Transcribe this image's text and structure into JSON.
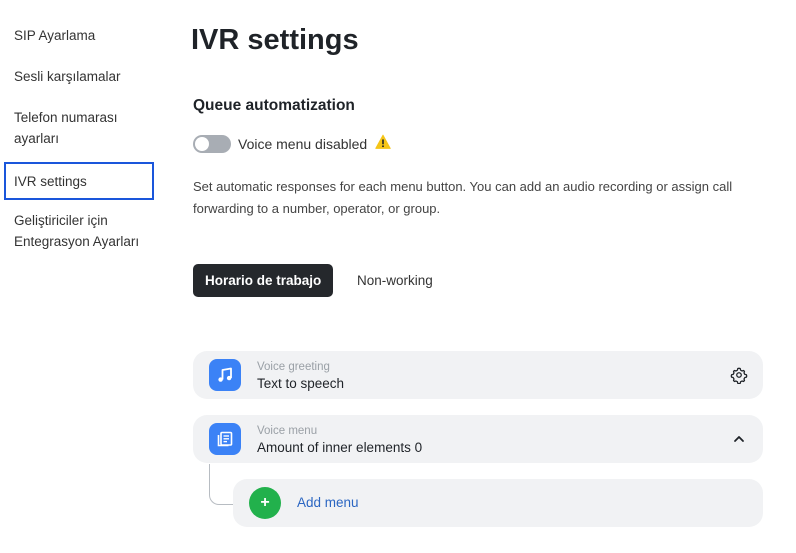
{
  "sidebar": {
    "items": [
      {
        "label": "SIP Ayarlama"
      },
      {
        "label": "Sesli karşılamalar"
      },
      {
        "label": "Telefon numarası ayarları"
      },
      {
        "label": "IVR settings"
      },
      {
        "label": "Geliştiriciler için Entegrasyon Ayarları"
      }
    ]
  },
  "page": {
    "title": "IVR settings",
    "section_title": "Queue automatization",
    "toggle_label": "Voice menu disabled",
    "description": "Set automatic responses for each menu button. You can add an audio recording or assign call forwarding to a number, operator, or group."
  },
  "tabs": [
    {
      "label": "Horario de trabajo"
    },
    {
      "label": "Non-working"
    }
  ],
  "cards": {
    "greeting": {
      "caption": "Voice greeting",
      "value": "Text to speech"
    },
    "menu": {
      "caption": "Voice menu",
      "value": "Amount of inner elements 0"
    },
    "add": {
      "label": "Add menu"
    }
  },
  "colors": {
    "accent_blue": "#3b82f6",
    "active_outline": "#1a56db",
    "add_green": "#22b14c",
    "warning": "#f5c518",
    "link": "#2b66c2"
  },
  "icons": {
    "warning": "warning-triangle-icon",
    "greeting": "music-note-icon",
    "menu": "document-list-icon",
    "settings": "gear-icon",
    "collapse": "chevron-up-icon",
    "add": "plus-icon"
  }
}
